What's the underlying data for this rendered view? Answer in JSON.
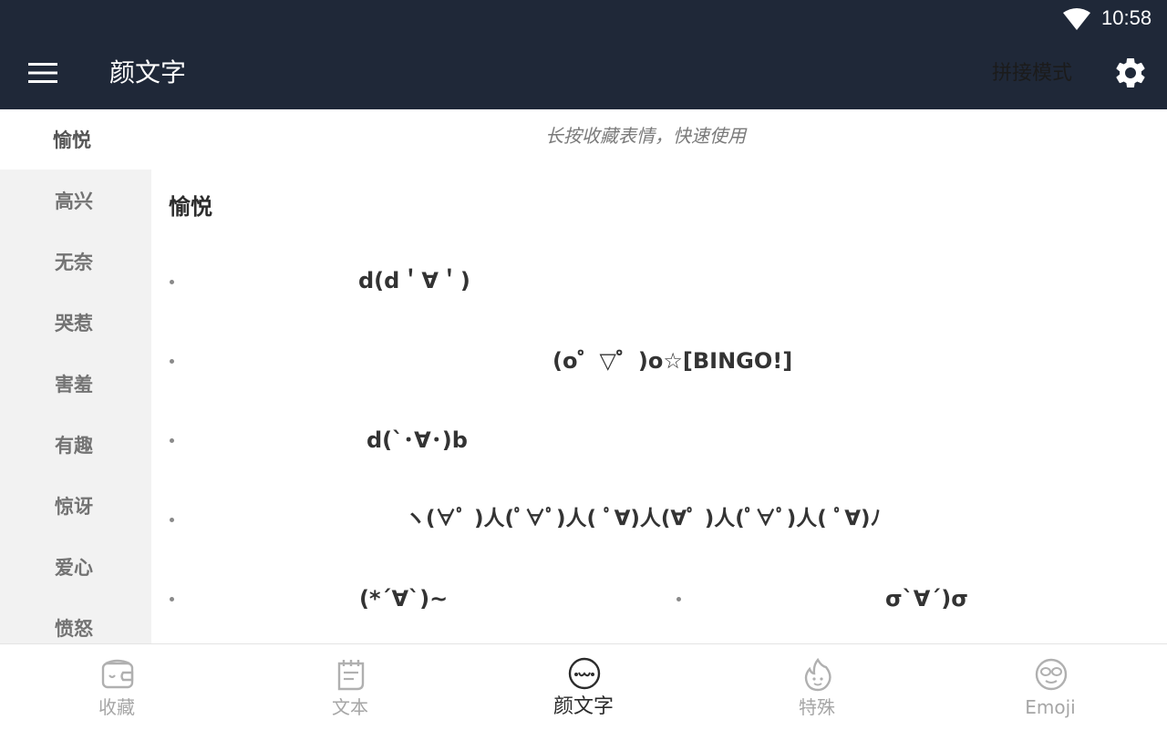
{
  "status": {
    "time": "10:58"
  },
  "appbar": {
    "title": "颜文字",
    "mode_label": "拼接模式"
  },
  "sidebar": {
    "items": [
      {
        "label": "愉悦"
      },
      {
        "label": "高兴"
      },
      {
        "label": "无奈"
      },
      {
        "label": "哭惹"
      },
      {
        "label": "害羞"
      },
      {
        "label": "有趣"
      },
      {
        "label": "惊讶"
      },
      {
        "label": "爱心"
      },
      {
        "label": "愤怒"
      }
    ]
  },
  "content": {
    "hint": "长按收藏表情，快速使用",
    "section_title": "愉悦",
    "kaomoji": [
      "d(d＇∀＇)",
      "(o゜▽゜)o☆[BINGO!]",
      "d(`･∀･)b",
      "ヽ(∀ﾟ )人(ﾟ∀ﾟ)人( ﾟ∀)人(∀ﾟ )人(ﾟ∀ﾟ)人( ﾟ∀)ﾉ",
      "(*´∀`)~",
      "σ`∀´)σ"
    ]
  },
  "tabs": [
    {
      "label": "收藏",
      "icon": "wallet-icon"
    },
    {
      "label": "文本",
      "icon": "notepad-icon"
    },
    {
      "label": "颜文字",
      "icon": "kaomoji-face-icon"
    },
    {
      "label": "特殊",
      "icon": "flame-icon"
    },
    {
      "label": "Emoji",
      "icon": "emoji-face-icon"
    }
  ],
  "colors": {
    "appbar_bg": "#1f2838",
    "sidebar_bg": "#f2f2f2",
    "active_tab_text": "#2b2b2b",
    "inactive_tab_text": "#a6a6a6"
  }
}
